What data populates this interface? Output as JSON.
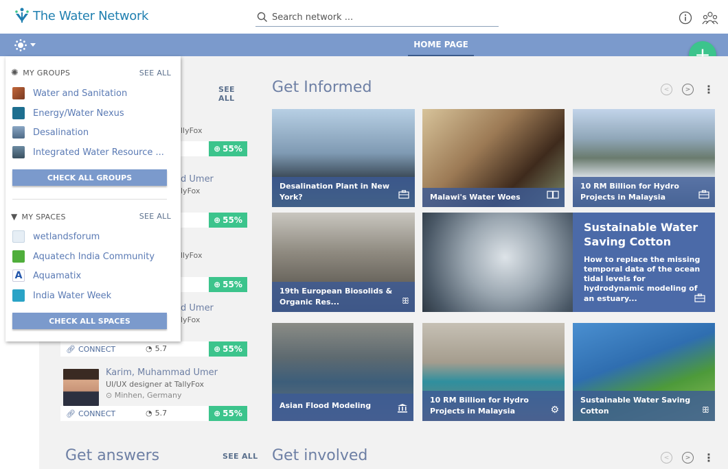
{
  "app": {
    "name": "The Water Network"
  },
  "search": {
    "placeholder": "Search network ..."
  },
  "nav": {
    "home": "HOME PAGE"
  },
  "colors": {
    "brand": "#1f7fb0",
    "nav": "#7b9acc",
    "accent": "#3cc48c",
    "caption": "#3c5a96"
  },
  "people": {
    "see_all": "SEE ALL",
    "rows": [
      {
        "name_partial": "",
        "role_partial": "llyFox",
        "pct": "55%"
      },
      {
        "name_partial": "d Umer",
        "role_partial": "lyFox",
        "pct": "55%"
      },
      {
        "name_partial": "",
        "role_partial": "llyFox",
        "pct": "55%"
      },
      {
        "name_partial": "d Umer",
        "role_partial": "lyFox",
        "pct": "55%"
      }
    ],
    "partial_bar": {
      "connect": "CONNECT",
      "score": "5.7",
      "pct": "55%"
    },
    "full": {
      "name": "Karim, Muhammad Umer",
      "role": "UI/UX designer at TallyFox",
      "location": "Minhen, Germany",
      "connect": "CONNECT",
      "score": "5.7",
      "pct": "55%"
    }
  },
  "dropdown": {
    "groups_title": "MY GROUPS",
    "groups_see_all": "SEE ALL",
    "groups": [
      "Water and Sanitation",
      "Energy/Water Nexus",
      "Desalination",
      "Integrated Water Resource ..."
    ],
    "groups_button": "CHECK ALL GROUPS",
    "spaces_title": "MY SPACES",
    "spaces_see_all": "SEE ALL",
    "spaces": [
      "wetlandsforum",
      "Aquatech India Community",
      "Aquamatix",
      "India Water Week"
    ],
    "spaces_button": "CHECK ALL SPACES"
  },
  "informed": {
    "title": "Get Informed",
    "tiles": [
      {
        "caption": "Desalination Plant in New York?",
        "icon": "briefcase-icon"
      },
      {
        "caption": "Malawi's Water Woes",
        "icon": "book-icon"
      },
      {
        "caption": "10 RM Billion for Hydro Projects in Malaysia",
        "icon": "briefcase-icon"
      },
      {
        "caption": "19th European Biosolids & Organic Res...",
        "icon": "people-icon"
      },
      {
        "caption": "Asian Flood Modeling",
        "icon": "institution-icon"
      },
      {
        "caption": "10 RM Billion for Hydro Projects in Malaysia",
        "icon": "gear-icon"
      },
      {
        "caption": "Sustainable Water Saving Cotton",
        "icon": "people-icon"
      }
    ],
    "featured": {
      "title": "Sustainable Water Saving Cotton",
      "text": "How to replace the missing temporal data of the ocean tidal levels for hydrodynamic modeling of an estuary...",
      "icon": "briefcase-icon"
    }
  },
  "answers": {
    "title": "Get answers",
    "see_all": "SEE ALL"
  },
  "involved": {
    "title": "Get involved"
  }
}
